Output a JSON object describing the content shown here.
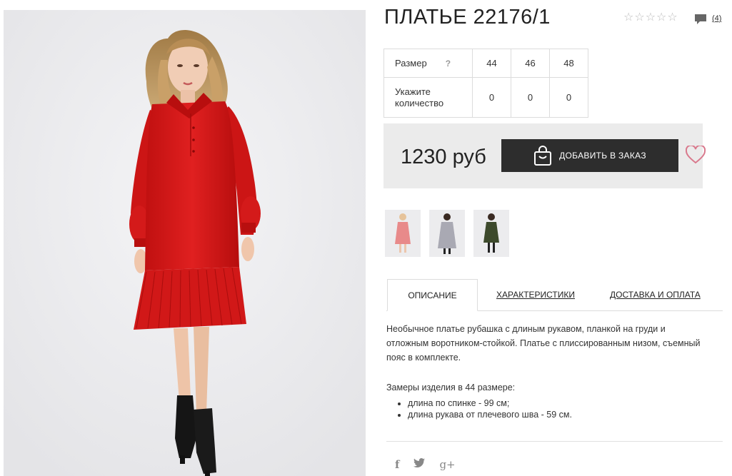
{
  "product": {
    "title": "ПЛАТЬЕ 22176/1",
    "rating": {
      "filled": 0,
      "max": 5
    },
    "review_count": "(4)"
  },
  "size_table": {
    "size_label": "Размер",
    "help_icon": "?",
    "quantity_label": "Укажите количество",
    "sizes": [
      "44",
      "46",
      "48"
    ],
    "quantities": [
      "0",
      "0",
      "0"
    ]
  },
  "purchase": {
    "price": "1230 руб",
    "add_button_label": "ДОБАВИТЬ В ЗАКАЗ",
    "button_icon": "shopping-bag-icon",
    "favorite_icon": "heart-icon"
  },
  "color_thumbnails": [
    {
      "color": "#e88a8a",
      "icon": "pink-dress-thumbnail"
    },
    {
      "color": "#a9a9b3",
      "icon": "grey-dress-thumbnail"
    },
    {
      "color": "#3d4a2c",
      "icon": "olive-dress-thumbnail"
    }
  ],
  "tabs": [
    {
      "label": "ОПИСАНИЕ",
      "active": true
    },
    {
      "label": "ХАРАКТЕРИСТИКИ",
      "active": false
    },
    {
      "label": "ДОСТАВКА И ОПЛАТА",
      "active": false
    }
  ],
  "description": {
    "text": "Необычное платье рубашка с длиным рукавом, планкой на груди и отложным воротником-стойкой. Платье с плиссированным низом, съемный пояс в комплекте.",
    "measures_title": "Замеры изделия в 44 размере:",
    "measures": [
      "длина по спинке - 99 см;",
      "длина рукава от плечевого шва - 59 см."
    ]
  },
  "social": [
    "f",
    "twitter-icon",
    "g+"
  ],
  "colors": {
    "dress": "#d81e1e",
    "button_bg": "#2d2d2d",
    "heart": "#d9788c",
    "price_box_bg": "#ebebeb"
  }
}
